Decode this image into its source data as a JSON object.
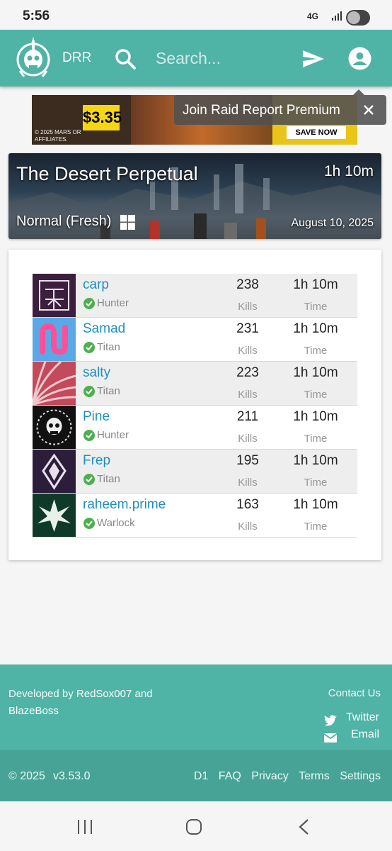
{
  "status_bar": {
    "time": "5:56",
    "network": "4G"
  },
  "app_bar": {
    "brand": "DRR",
    "search_placeholder": "Search..."
  },
  "ad": {
    "price": "$3.35",
    "disclaimer": "© 2025 MARS OR AFFILIATES.",
    "cta": "SAVE NOW"
  },
  "tooltip": {
    "label": "Join Raid Report Premium"
  },
  "activity": {
    "title": "The Desert Perpetual",
    "duration": "1h 10m",
    "mode": "Normal (Fresh)",
    "date": "August 10, 2025",
    "platform_icon": "windows-icon"
  },
  "players": [
    {
      "name": "carp",
      "class": "Hunter",
      "kills": "238",
      "kills_label": "Kills",
      "time": "1h 10m",
      "time_label": "Time"
    },
    {
      "name": "Samad",
      "class": "Titan",
      "kills": "231",
      "kills_label": "Kills",
      "time": "1h 10m",
      "time_label": "Time"
    },
    {
      "name": "salty",
      "class": "Titan",
      "kills": "223",
      "kills_label": "Kills",
      "time": "1h 10m",
      "time_label": "Time"
    },
    {
      "name": "Pine",
      "class": "Hunter",
      "kills": "211",
      "kills_label": "Kills",
      "time": "1h 10m",
      "time_label": "Time"
    },
    {
      "name": "Frep",
      "class": "Titan",
      "kills": "195",
      "kills_label": "Kills",
      "time": "1h 10m",
      "time_label": "Time"
    },
    {
      "name": "raheem.prime",
      "class": "Warlock",
      "kills": "163",
      "kills_label": "Kills",
      "time": "1h 10m",
      "time_label": "Time"
    }
  ],
  "footer": {
    "developed_prefix": "Developed by ",
    "dev1": "RedSox007",
    "and": " and ",
    "dev2": "BlazeBoss",
    "contact": "Contact Us",
    "twitter": "Twitter",
    "email": "Email",
    "copyright": "© 2025",
    "version": "v3.53.0",
    "links": [
      "D1",
      "FAQ",
      "Privacy",
      "Terms",
      "Settings"
    ]
  },
  "colors": {
    "accent": "#4fb3a6",
    "link": "#1e8fbf",
    "verified": "#4caf50"
  }
}
